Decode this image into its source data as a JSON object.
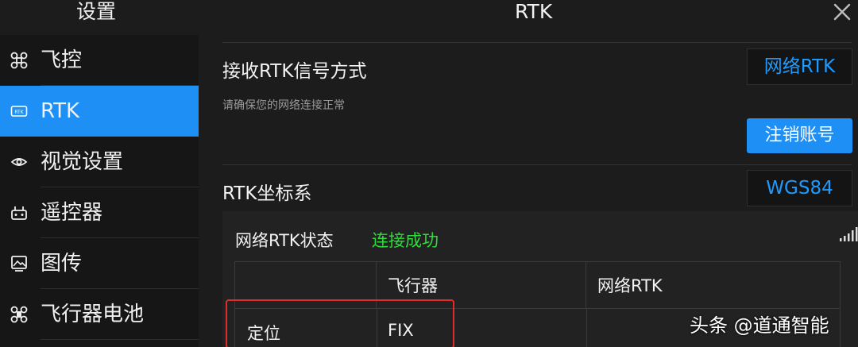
{
  "header": {
    "settings_title": "设置",
    "page_title": "RTK",
    "close_icon": "close-icon"
  },
  "sidebar": {
    "items": [
      {
        "label": "飞控",
        "icon": "drone-icon",
        "active": false
      },
      {
        "label": "RTK",
        "icon": "rtk-icon",
        "active": true
      },
      {
        "label": "视觉设置",
        "icon": "eye-icon",
        "active": false
      },
      {
        "label": "遥控器",
        "icon": "remote-controller-icon",
        "active": false
      },
      {
        "label": "图传",
        "icon": "image-transmission-icon",
        "active": false
      },
      {
        "label": "飞行器电池",
        "icon": "battery-icon",
        "active": false
      }
    ]
  },
  "main": {
    "receive_label": "接收RTK信号方式",
    "receive_value": "网络RTK",
    "receive_hint": "请确保您的网络连接正常",
    "logout_label": "注销账号",
    "coord_label": "RTK坐标系",
    "coord_value": "WGS84",
    "status": {
      "label": "网络RTK状态",
      "value": "连接成功",
      "value_color": "#2ddd3b",
      "signal_icon": "signal-strength-icon"
    },
    "table": {
      "headers": [
        "",
        "飞行器",
        "网络RTK"
      ],
      "rows": [
        {
          "label": "定位",
          "aircraft": "FIX",
          "network": ""
        }
      ]
    }
  },
  "watermark": "头条 @道通智能",
  "colors": {
    "accent": "#1e90f5",
    "value_text": "#1e9bff",
    "highlight": "#e02b2b"
  }
}
